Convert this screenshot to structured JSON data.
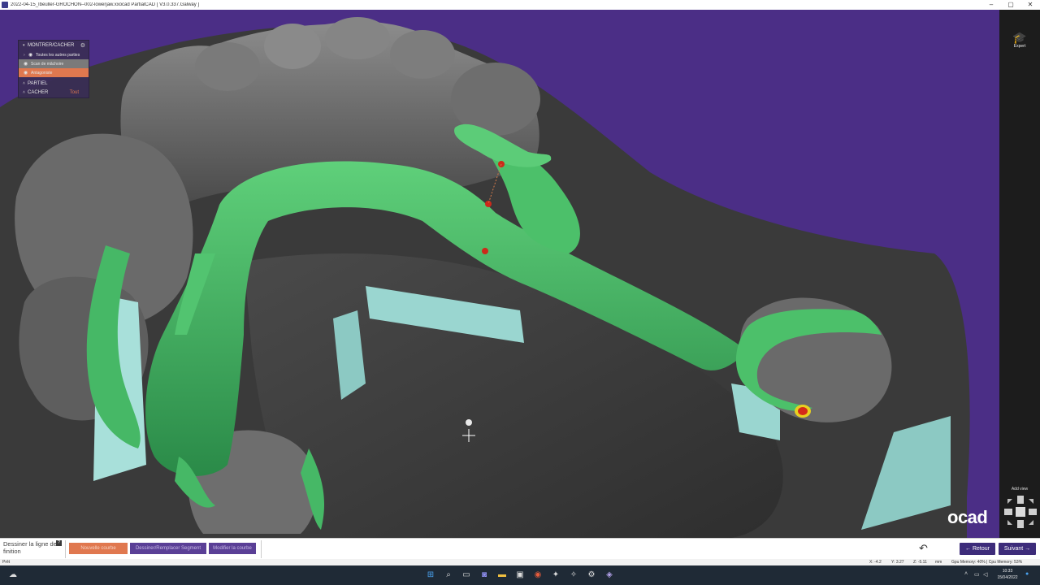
{
  "window": {
    "title": "2022-04-15_Ibeuller-GROCHON--002-lowerjaw.xxocad PartialCAD [ V3.0.337.Galway ]",
    "minimize": "–",
    "maximize": "▢",
    "close": "✕"
  },
  "panel": {
    "header": "MONTRER/CACHER",
    "items": [
      "Toutes les autres parties",
      "Scan de mâchoire",
      "Antagoniste"
    ],
    "partiel": "PARTIEL",
    "cacher": "CACHER",
    "tout": "Tout"
  },
  "sidebar": {
    "expert_label": "Expert",
    "add_view_label": "Add view"
  },
  "brand": {
    "text": "ocad"
  },
  "toolbar": {
    "step_label": "Dessiner la ligne de finition",
    "help": "?",
    "buttons": [
      "Nouvelle courbe",
      "Dessiner/Remplacer Segment",
      "Modifier la courbe"
    ],
    "back": "Retour",
    "next": "Suivant"
  },
  "status": {
    "left": "Prêt",
    "x": "X: -4.2",
    "y": "Y: 3.27",
    "z": "Z: -5.11",
    "unit": "mm",
    "memory": "Gpu Memory: 40% | Cpu Memory: 53%"
  },
  "taskbar": {
    "time": "10:33",
    "date": "15/04/2022"
  },
  "colors": {
    "background": "#4b2e86",
    "framework_green": "#3aa85a",
    "accent_orange": "#e0784f",
    "accent_purple": "#3d2c7a"
  }
}
